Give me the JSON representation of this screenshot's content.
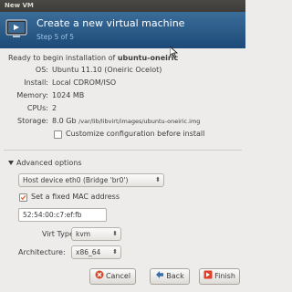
{
  "window": {
    "title": "New VM"
  },
  "header": {
    "title": "Create a new virtual machine",
    "step": "Step 5 of 5"
  },
  "summary": {
    "ready_prefix": "Ready to begin installation of",
    "vm_name": "ubuntu-oneiric",
    "rows": [
      {
        "label": "OS:",
        "value": "Ubuntu 11.10 (Oneiric Ocelot)"
      },
      {
        "label": "Install:",
        "value": "Local CDROM/ISO"
      },
      {
        "label": "Memory:",
        "value": "1024 MB"
      },
      {
        "label": "CPUs:",
        "value": "2"
      }
    ],
    "storage": {
      "label": "Storage:",
      "size": "8.0 Gb",
      "path": "/var/lib/libvirt/images/ubuntu-oneiric.img"
    },
    "customize_label": "Customize configuration before install",
    "customize_checked": false
  },
  "advanced": {
    "label": "Advanced options",
    "network_selected": "Host device eth0 (Bridge 'br0')",
    "fixed_mac_label": "Set a fixed MAC address",
    "fixed_mac_checked": true,
    "mac_value": "52:54:00:c7:ef:fb",
    "virt_type_label": "Virt Type:",
    "virt_type_value": "kvm",
    "arch_label": "Architecture:",
    "arch_value": "x86_64"
  },
  "buttons": {
    "cancel": "Cancel",
    "back": "Back",
    "finish": "Finish"
  },
  "colors": {
    "header_bg": "#1d4a78",
    "step_text": "#9ec3e6",
    "accent_check": "#e85a24"
  }
}
